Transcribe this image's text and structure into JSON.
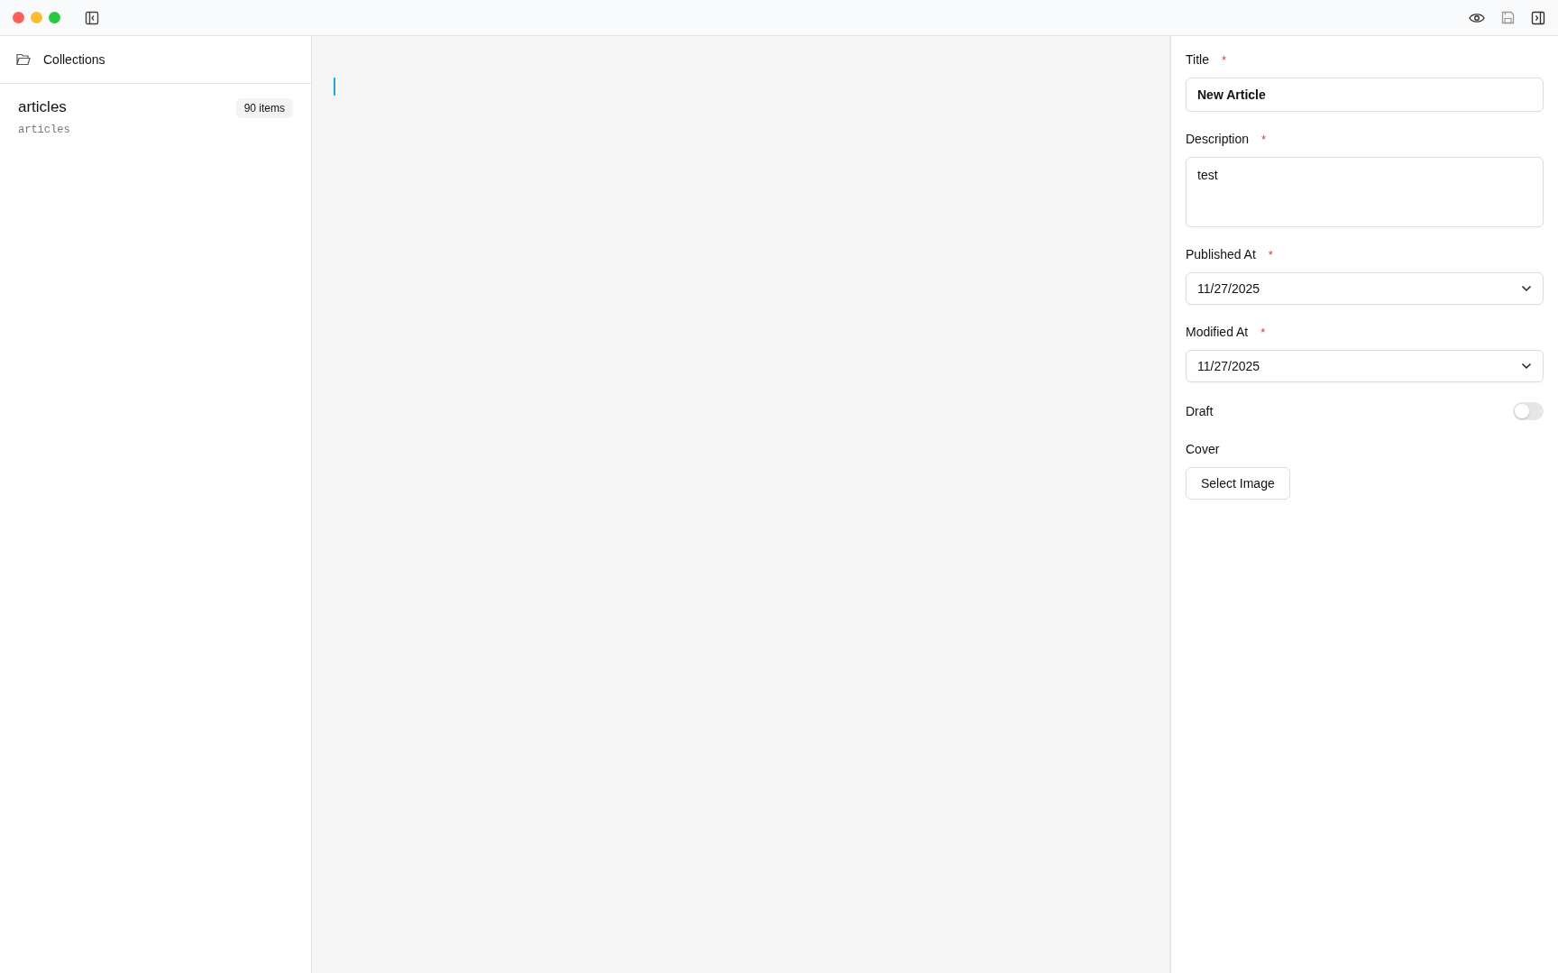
{
  "sidebar": {
    "header": "Collections",
    "collections": [
      {
        "name": "articles",
        "count": "90 items",
        "slug": "articles",
        "selected": false
      }
    ]
  },
  "form": {
    "fields": [
      {
        "kind": "text",
        "label": "Title",
        "required_mark": "*",
        "value": "New Article"
      },
      {
        "kind": "textarea",
        "label": "Description",
        "required_mark": "*",
        "value": "test"
      },
      {
        "kind": "date",
        "label": "Published At",
        "required_mark": "*",
        "value": "11/27/2025"
      },
      {
        "kind": "date",
        "label": "Modified At",
        "required_mark": "*",
        "value": "11/27/2025"
      },
      {
        "kind": "toggle",
        "label": "Draft",
        "on": false
      },
      {
        "kind": "image",
        "label": "Cover",
        "button": "Select Image"
      }
    ]
  }
}
